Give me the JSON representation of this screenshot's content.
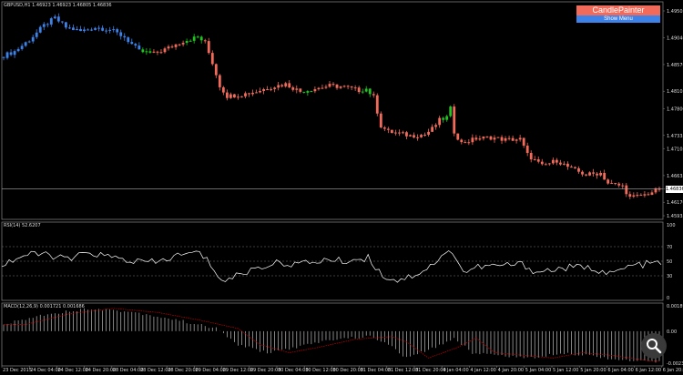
{
  "main_panel": {
    "title": "GBPUSD,H1  1.46923 1.46923 1.46805 1.46836",
    "current_price_label": "1.46836"
  },
  "rsi_panel": {
    "title": "RSI(14) 52.6207"
  },
  "macd_panel": {
    "title": "MACD(12,26,9) 0.001721 0.001686"
  },
  "candle_painter": {
    "title": "CandlePainter",
    "menu_label": "Show Menu"
  },
  "colors": {
    "bull": "#3d82e8",
    "bull_green": "#22c222",
    "bear": "#f26b5a",
    "grid": "#777777",
    "line": "#ffffff",
    "signal": "#cc0000"
  },
  "icons": {
    "zoom": "magnifier-zoom-icon"
  },
  "chart_data": [
    {
      "type": "candlestick",
      "title": "GBPUSD,H1",
      "y_ticks": [
        "1.49505",
        "1.49040",
        "1.48570",
        "1.48105",
        "1.47800",
        "1.47335",
        "1.47105",
        "1.46635",
        "1.46400",
        "1.46170",
        "1.45935"
      ],
      "ylim": [
        1.45935,
        1.49505
      ],
      "x_ticks": [
        "23 Dec 2015",
        "24 Dec 04:00",
        "24 Dec 12:00",
        "24 Dec 20:00",
        "28 Dec 04:00",
        "28 Dec 12:00",
        "28 Dec 20:00",
        "29 Dec 04:00",
        "29 Dec 12:00",
        "29 Dec 20:00",
        "30 Dec 04:00",
        "30 Dec 12:00",
        "30 Dec 20:00",
        "31 Dec 04:00",
        "31 Dec 12:00",
        "31 Dec 20:00",
        "4 Jan 04:00",
        "4 Jan 12:00",
        "4 Jan 20:00",
        "5 Jan 04:00",
        "5 Jan 12:00",
        "5 Jan 20:00",
        "6 Jan 04:00",
        "6 Jan 12:00",
        "6 Jan 20:00"
      ],
      "close_path": [
        [
          0,
          1.487
        ],
        [
          4,
          1.488
        ],
        [
          8,
          1.49
        ],
        [
          12,
          1.4925
        ],
        [
          15,
          1.4938
        ],
        [
          18,
          1.4922
        ],
        [
          22,
          1.4915
        ],
        [
          26,
          1.4922
        ],
        [
          30,
          1.4918
        ],
        [
          34,
          1.4905
        ],
        [
          38,
          1.488
        ],
        [
          42,
          1.4876
        ],
        [
          46,
          1.4886
        ],
        [
          50,
          1.4898
        ],
        [
          54,
          1.4905
        ],
        [
          56,
          1.4895
        ],
        [
          58,
          1.486
        ],
        [
          60,
          1.482
        ],
        [
          62,
          1.4802
        ],
        [
          66,
          1.4805
        ],
        [
          70,
          1.481
        ],
        [
          74,
          1.4818
        ],
        [
          78,
          1.4823
        ],
        [
          82,
          1.481
        ],
        [
          86,
          1.4815
        ],
        [
          90,
          1.482
        ],
        [
          94,
          1.4818
        ],
        [
          98,
          1.4812
        ],
        [
          100,
          1.4815
        ],
        [
          102,
          1.48
        ],
        [
          104,
          1.475
        ],
        [
          106,
          1.474
        ],
        [
          108,
          1.4738
        ],
        [
          112,
          1.4733
        ],
        [
          116,
          1.4735
        ],
        [
          118,
          1.4745
        ],
        [
          120,
          1.476
        ],
        [
          122,
          1.4765
        ],
        [
          123,
          1.478
        ],
        [
          124,
          1.474
        ],
        [
          126,
          1.472
        ],
        [
          130,
          1.4728
        ],
        [
          134,
          1.473
        ],
        [
          138,
          1.4726
        ],
        [
          142,
          1.4727
        ],
        [
          144,
          1.47
        ],
        [
          148,
          1.468
        ],
        [
          152,
          1.469
        ],
        [
          156,
          1.4675
        ],
        [
          160,
          1.4665
        ],
        [
          164,
          1.4668
        ],
        [
          166,
          1.465
        ],
        [
          170,
          1.4645
        ],
        [
          172,
          1.4625
        ],
        [
          176,
          1.463
        ],
        [
          180,
          1.464
        ]
      ],
      "n_candles": 180
    },
    {
      "type": "line",
      "title": "RSI(14) 52.6207",
      "y_ticks": [
        "100",
        "70",
        "50",
        "30",
        "0"
      ],
      "ylim": [
        0,
        100
      ],
      "levels": [
        70,
        50,
        30
      ],
      "rsi_path": [
        [
          0,
          45
        ],
        [
          6,
          58
        ],
        [
          12,
          60
        ],
        [
          18,
          52
        ],
        [
          24,
          62
        ],
        [
          30,
          55
        ],
        [
          36,
          50
        ],
        [
          42,
          48
        ],
        [
          48,
          58
        ],
        [
          54,
          62
        ],
        [
          58,
          40
        ],
        [
          60,
          22
        ],
        [
          64,
          30
        ],
        [
          70,
          42
        ],
        [
          76,
          48
        ],
        [
          82,
          46
        ],
        [
          88,
          52
        ],
        [
          94,
          50
        ],
        [
          100,
          55
        ],
        [
          104,
          30
        ],
        [
          108,
          24
        ],
        [
          112,
          30
        ],
        [
          116,
          40
        ],
        [
          120,
          55
        ],
        [
          123,
          65
        ],
        [
          126,
          35
        ],
        [
          130,
          42
        ],
        [
          136,
          44
        ],
        [
          142,
          46
        ],
        [
          146,
          35
        ],
        [
          150,
          38
        ],
        [
          156,
          42
        ],
        [
          162,
          40
        ],
        [
          166,
          32
        ],
        [
          172,
          44
        ],
        [
          180,
          48
        ]
      ]
    },
    {
      "type": "bar",
      "title": "MACD(12,26,9) 0.001721 0.001686",
      "y_ticks": [
        "0.00189",
        "0.00",
        "-0.002382"
      ],
      "ylim": [
        -0.002382,
        0.00189
      ],
      "macd_path": [
        [
          0,
          0.0005
        ],
        [
          12,
          0.0013
        ],
        [
          24,
          0.0017
        ],
        [
          36,
          0.0014
        ],
        [
          48,
          0.0008
        ],
        [
          58,
          0.0002
        ],
        [
          64,
          -0.001
        ],
        [
          72,
          -0.0016
        ],
        [
          80,
          -0.0012
        ],
        [
          90,
          -0.0006
        ],
        [
          100,
          -0.0004
        ],
        [
          104,
          -0.0008
        ],
        [
          110,
          -0.002
        ],
        [
          118,
          -0.0012
        ],
        [
          123,
          -0.0005
        ],
        [
          128,
          -0.0016
        ],
        [
          136,
          -0.0018
        ],
        [
          144,
          -0.002
        ],
        [
          152,
          -0.0016
        ],
        [
          160,
          -0.0018
        ],
        [
          170,
          -0.0022
        ],
        [
          180,
          -0.0023
        ]
      ]
    }
  ]
}
